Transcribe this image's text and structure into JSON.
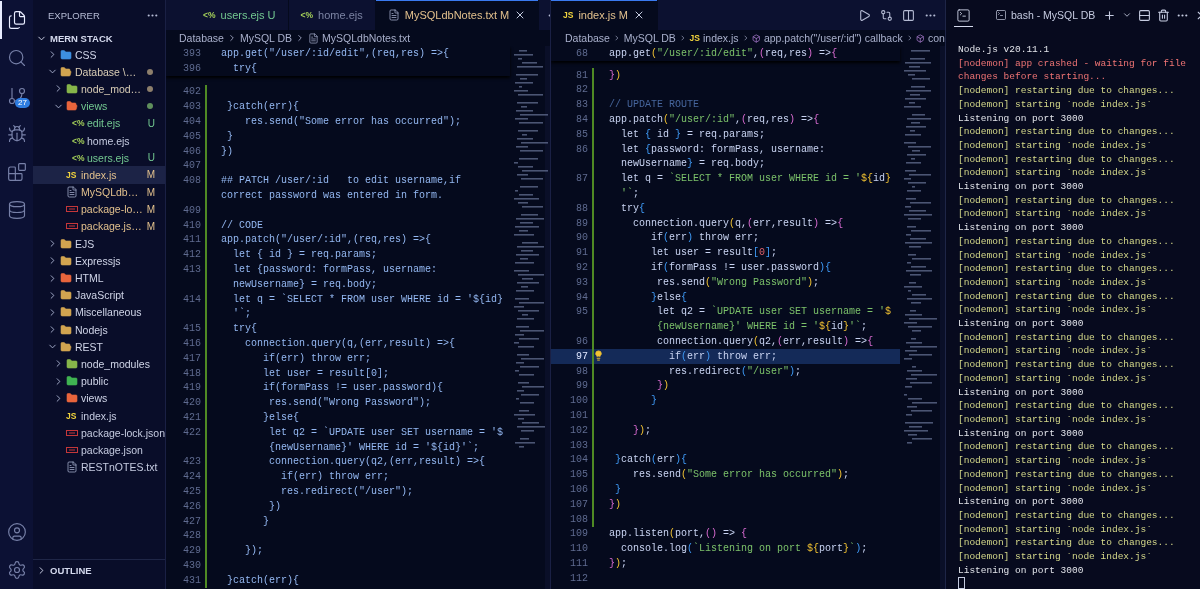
{
  "activity_bar": {
    "top": [
      {
        "kind": "explorer",
        "selected": true
      },
      {
        "kind": "search",
        "selected": false
      },
      {
        "kind": "source-control",
        "selected": false,
        "badge": "27"
      },
      {
        "kind": "run-debug",
        "selected": false
      },
      {
        "kind": "extensions",
        "selected": false
      },
      {
        "kind": "database",
        "selected": false
      }
    ],
    "bottom": [
      {
        "kind": "account",
        "selected": false
      },
      {
        "kind": "settings",
        "selected": false
      }
    ]
  },
  "sidebar": {
    "title": "EXPLORER",
    "workspace": {
      "label": "MERN STACK",
      "expanded": true
    },
    "tree": [
      {
        "label": "CSS",
        "kind": "css-folder",
        "expanded": false,
        "selected": false,
        "modified": false,
        "untracked": false
      },
      {
        "label": "Database \\…",
        "kind": "folder",
        "expanded": true,
        "selected": false,
        "modified": true,
        "untracked": false,
        "dot": true,
        "children": [
          {
            "label": "node_mod…",
            "kind": "node-folder",
            "expanded": false,
            "selected": false,
            "modified": true,
            "untracked": false,
            "dot": true
          },
          {
            "label": "views",
            "kind": "views-folder",
            "expanded": true,
            "selected": false,
            "modified": false,
            "untracked": true,
            "dot": true,
            "children": [
              {
                "label": "edit.ejs",
                "kind": "ejs",
                "icon_text": "<%",
                "selected": false,
                "modified": false,
                "untracked": true,
                "badge": "U"
              },
              {
                "label": "home.ejs",
                "kind": "ejs",
                "icon_text": "<%",
                "selected": false,
                "modified": false,
                "untracked": false
              },
              {
                "label": "users.ejs",
                "kind": "ejs",
                "icon_text": "<%",
                "selected": false,
                "modified": false,
                "untracked": true,
                "badge": "U"
              }
            ]
          },
          {
            "label": "index.js",
            "kind": "js",
            "icon_text": "JS",
            "selected": true,
            "modified": true,
            "untracked": false,
            "badge": "M"
          },
          {
            "label": "MySQLdb…",
            "kind": "txt",
            "selected": false,
            "modified": true,
            "untracked": false,
            "badge": "M"
          },
          {
            "label": "package-lo…",
            "kind": "json",
            "selected": false,
            "modified": true,
            "untracked": false,
            "badge": "M"
          },
          {
            "label": "package.js…",
            "kind": "json",
            "selected": false,
            "modified": true,
            "untracked": false,
            "badge": "M"
          }
        ]
      },
      {
        "label": "EJS",
        "kind": "folder",
        "expanded": false,
        "selected": false,
        "modified": false,
        "untracked": false
      },
      {
        "label": "Expressjs",
        "kind": "folder",
        "expanded": false,
        "selected": false,
        "modified": false,
        "untracked": false
      },
      {
        "label": "HTML",
        "kind": "html-folder",
        "expanded": false,
        "selected": false,
        "modified": false,
        "untracked": false
      },
      {
        "label": "JavaScript",
        "kind": "folder",
        "expanded": false,
        "selected": false,
        "modified": false,
        "untracked": false
      },
      {
        "label": "Miscellaneous",
        "kind": "folder",
        "expanded": false,
        "selected": false,
        "modified": false,
        "untracked": false
      },
      {
        "label": "Nodejs",
        "kind": "folder",
        "expanded": false,
        "selected": false,
        "modified": false,
        "untracked": false
      },
      {
        "label": "REST",
        "kind": "folder",
        "expanded": true,
        "selected": false,
        "modified": false,
        "untracked": false,
        "children": [
          {
            "label": "node_modules",
            "kind": "node-folder",
            "expanded": false,
            "selected": false,
            "modified": false,
            "untracked": false
          },
          {
            "label": "public",
            "kind": "public-folder",
            "expanded": false,
            "selected": false,
            "modified": false,
            "untracked": false
          },
          {
            "label": "views",
            "kind": "views-folder",
            "expanded": false,
            "selected": false,
            "modified": false,
            "untracked": false
          },
          {
            "label": "index.js",
            "kind": "js",
            "icon_text": "JS",
            "selected": false,
            "modified": false,
            "untracked": false
          },
          {
            "label": "package-lock.json",
            "kind": "json",
            "selected": false,
            "modified": false,
            "untracked": false
          },
          {
            "label": "package.json",
            "kind": "json",
            "selected": false,
            "modified": false,
            "untracked": false
          },
          {
            "label": "RESTnOTES.txt",
            "kind": "txt",
            "selected": false,
            "modified": false,
            "untracked": false
          }
        ]
      }
    ],
    "sections": [
      {
        "label": "OUTLINE",
        "expanded": false
      }
    ]
  },
  "editors": [
    {
      "kind": "text",
      "tabs": [
        {
          "label": "users.ejs",
          "badge": "U",
          "kind": "ejs",
          "icon_text": "<%",
          "modified": false,
          "untracked": true,
          "selected": false
        },
        {
          "label": "home.ejs",
          "kind": "ejs",
          "icon_text": "<%",
          "modified": false,
          "untracked": false,
          "selected": false
        },
        {
          "label": "MySQLdbNotes.txt",
          "badge": "M",
          "kind": "txt",
          "modified": true,
          "untracked": false,
          "selected": true
        }
      ],
      "actions": [
        {
          "kind": "more"
        }
      ],
      "breadcrumbs": [
        {
          "kind": "folder",
          "label": "Database"
        },
        {
          "kind": "folder",
          "label": "MySQL DB"
        },
        {
          "kind": "txt",
          "label": "MySQLdbNotes.txt"
        }
      ],
      "sticky": [
        {
          "number": "393",
          "text": "app.get(\"/user/:id/edit\",(req,res) =>{"
        },
        {
          "number": "396",
          "text": "  try{"
        }
      ],
      "lines": [
        {
          "number": "402",
          "changed": true
        },
        {
          "number": "403",
          "text": " }catch(err){",
          "changed": true
        },
        {
          "number": "404",
          "text": "    res.send(\"Some error has occurred\");",
          "changed": true
        },
        {
          "number": "405",
          "text": " }",
          "changed": true
        },
        {
          "number": "406",
          "text": "})",
          "changed": true
        },
        {
          "number": "407",
          "changed": true
        },
        {
          "number": "408",
          "text": "## PATCH /user/:id   to edit username,if",
          "changed": true
        },
        {
          "text": "correct password was entered in form.",
          "changed": true
        },
        {
          "number": "409",
          "changed": true
        },
        {
          "number": "410",
          "text": "// CODE",
          "changed": true
        },
        {
          "number": "411",
          "text": "app.patch(\"/user/:id\",(req,res) =>{",
          "changed": true
        },
        {
          "number": "412",
          "text": "  let { id } = req.params;",
          "changed": true
        },
        {
          "number": "413",
          "text": "  let {password: formPass, username:",
          "changed": true
        },
        {
          "text": "  newUsername} = req.body;",
          "changed": true
        },
        {
          "number": "414",
          "text": "  let q = `SELECT * FROM user WHERE id = '${id}",
          "changed": true
        },
        {
          "text": "  '`;",
          "changed": true
        },
        {
          "number": "415",
          "text": "  try{",
          "changed": true
        },
        {
          "number": "416",
          "text": "    connection.query(q,(err,result) =>{",
          "changed": true
        },
        {
          "number": "417",
          "text": "       if(err) throw err;",
          "changed": true
        },
        {
          "number": "418",
          "text": "       let user = result[0];",
          "changed": true
        },
        {
          "number": "419",
          "text": "       if(formPass != user.password){",
          "changed": true
        },
        {
          "number": "420",
          "text": "        res.send(\"Wrong Password\");",
          "changed": true
        },
        {
          "number": "421",
          "text": "       }else{",
          "changed": true
        },
        {
          "number": "422",
          "text": "        let q2 = `UPDATE user SET username = '$",
          "changed": true
        },
        {
          "text": "        {newUsername}' WHERE id = '${id}'`;",
          "changed": true
        },
        {
          "number": "423",
          "text": "        connection.query(q2,(err,result) =>{",
          "changed": true
        },
        {
          "number": "424",
          "text": "          if(err) throw err;",
          "changed": true
        },
        {
          "number": "425",
          "text": "          res.redirect(\"/user\");",
          "changed": true
        },
        {
          "number": "426",
          "text": "        })",
          "changed": true
        },
        {
          "number": "427",
          "text": "       }",
          "changed": true
        },
        {
          "number": "428",
          "changed": true
        },
        {
          "number": "429",
          "text": "    });",
          "changed": true
        },
        {
          "number": "430",
          "changed": true
        },
        {
          "number": "431",
          "text": " }catch(err){",
          "changed": true
        }
      ]
    },
    {
      "kind": "javascript",
      "tabs": [
        {
          "label": "index.js",
          "badge": "M",
          "kind": "js",
          "icon_text": "JS",
          "modified": true,
          "untracked": false,
          "selected": true
        }
      ],
      "actions": [
        {
          "kind": "run"
        },
        {
          "kind": "compare"
        },
        {
          "kind": "split"
        },
        {
          "kind": "more"
        }
      ],
      "breadcrumbs": [
        {
          "kind": "folder",
          "label": "Database"
        },
        {
          "kind": "folder",
          "label": "MySQL DB"
        },
        {
          "kind": "js",
          "icon_text": "JS",
          "label": "index.js"
        },
        {
          "kind": "symbol",
          "label": "app.patch(\"/user/:id\") callback"
        },
        {
          "kind": "symbol",
          "label": "con"
        }
      ],
      "sticky": [
        {
          "number": "68",
          "text": "app.get(\"/user/:id/edit\",(req,res) =>{"
        }
      ],
      "lines": [
        {
          "number": "81",
          "text": "})",
          "changed": true,
          "current": false
        },
        {
          "number": "82",
          "changed": true,
          "current": false
        },
        {
          "number": "83",
          "text": "// UPDATE ROUTE",
          "changed": true,
          "current": false
        },
        {
          "number": "84",
          "text": "app.patch(\"/user/:id\",(req,res) =>{",
          "changed": true,
          "current": false
        },
        {
          "number": "85",
          "text": "  let { id } = req.params;",
          "changed": true,
          "current": false
        },
        {
          "number": "86",
          "text": "  let {password: formPass, username:",
          "changed": true,
          "current": false
        },
        {
          "text": "  newUsername} = req.body;",
          "changed": true,
          "current": false
        },
        {
          "number": "87",
          "text": "  let q = `SELECT * FROM user WHERE id = '${id}",
          "changed": true,
          "current": false
        },
        {
          "text": "  '`;",
          "changed": true,
          "current": false
        },
        {
          "number": "88",
          "text": "  try{",
          "changed": true,
          "current": false
        },
        {
          "number": "89",
          "text": "    connection.query(q,(err,result) =>{",
          "changed": true,
          "current": false
        },
        {
          "number": "90",
          "text": "       if(err) throw err;",
          "changed": true,
          "current": false
        },
        {
          "number": "91",
          "text": "       let user = result[0];",
          "changed": true,
          "current": false
        },
        {
          "number": "92",
          "text": "       if(formPass != user.password){",
          "changed": true,
          "current": false
        },
        {
          "number": "93",
          "text": "        res.send(\"Wrong Password\");",
          "changed": true,
          "current": false
        },
        {
          "number": "94",
          "text": "       }else{",
          "changed": true,
          "current": false
        },
        {
          "number": "95",
          "text": "        let q2 = `UPDATE user SET username = '$",
          "changed": true,
          "current": false
        },
        {
          "text": "        {newUsername}' WHERE id = '${id}'`;",
          "changed": true,
          "current": false
        },
        {
          "number": "96",
          "text": "        connection.query(q2,(err,result) =>{",
          "changed": true,
          "current": false
        },
        {
          "number": "97",
          "text": "          if(err) throw err;",
          "changed": true,
          "current": true
        },
        {
          "number": "98",
          "text": "          res.redirect(\"/user\");",
          "changed": true,
          "current": false
        },
        {
          "number": "99",
          "text": "        })",
          "changed": true,
          "current": false
        },
        {
          "number": "100",
          "text": "       }",
          "changed": true,
          "current": false
        },
        {
          "number": "101",
          "changed": true,
          "current": false
        },
        {
          "number": "102",
          "text": "    });",
          "changed": true,
          "current": false
        },
        {
          "number": "103",
          "changed": true,
          "current": false
        },
        {
          "number": "104",
          "text": " }catch(err){",
          "changed": true,
          "current": false
        },
        {
          "number": "105",
          "text": "    res.send(\"Some error has occurred\");",
          "changed": true,
          "current": false
        },
        {
          "number": "106",
          "text": " }",
          "changed": true,
          "current": false
        },
        {
          "number": "107",
          "text": "})",
          "changed": true,
          "current": false
        },
        {
          "number": "108",
          "changed": true,
          "current": false
        },
        {
          "number": "109",
          "text": "app.listen(port,() => {",
          "changed": false,
          "current": false
        },
        {
          "number": "110",
          "text": "  console.log(`Listening on port ${port}`);",
          "changed": false,
          "current": false
        },
        {
          "number": "111",
          "text": "});",
          "changed": false,
          "current": false
        },
        {
          "number": "112",
          "changed": false,
          "current": false
        }
      ]
    }
  ],
  "terminal": {
    "views": [
      {
        "kind": "terminal",
        "selected": true
      }
    ],
    "title": "bash - MySQL DB",
    "actions": [
      {
        "kind": "add"
      },
      {
        "kind": "dropdown"
      },
      {
        "kind": "split"
      },
      {
        "kind": "kill"
      },
      {
        "kind": "more"
      },
      {
        "kind": "close"
      }
    ],
    "lines": [
      {
        "kind": "info",
        "text": "Node.js v20.11.1"
      },
      {
        "kind": "error",
        "text": "[nodemon] app crashed - waiting for file changes before starting..."
      },
      {
        "kind": "nodemon",
        "text": "[nodemon] restarting due to changes..."
      },
      {
        "kind": "nodemon",
        "text": "[nodemon] starting `node index.js`"
      },
      {
        "kind": "info",
        "text": "Listening on port 3000"
      },
      {
        "kind": "nodemon",
        "text": "[nodemon] restarting due to changes..."
      },
      {
        "kind": "nodemon",
        "text": "[nodemon] starting `node index.js`"
      },
      {
        "kind": "nodemon",
        "text": "[nodemon] restarting due to changes..."
      },
      {
        "kind": "nodemon",
        "text": "[nodemon] starting `node index.js`"
      },
      {
        "kind": "info",
        "text": "Listening on port 3000"
      },
      {
        "kind": "nodemon",
        "text": "[nodemon] restarting due to changes..."
      },
      {
        "kind": "nodemon",
        "text": "[nodemon] starting `node index.js`"
      },
      {
        "kind": "info",
        "text": "Listening on port 3000"
      },
      {
        "kind": "nodemon",
        "text": "[nodemon] restarting due to changes..."
      },
      {
        "kind": "nodemon",
        "text": "[nodemon] starting `node index.js`"
      },
      {
        "kind": "nodemon",
        "text": "[nodemon] restarting due to changes..."
      },
      {
        "kind": "nodemon",
        "text": "[nodemon] starting `node index.js`"
      },
      {
        "kind": "nodemon",
        "text": "[nodemon] restarting due to changes..."
      },
      {
        "kind": "nodemon",
        "text": "[nodemon] starting `node index.js`"
      },
      {
        "kind": "info",
        "text": "Listening on port 3000"
      },
      {
        "kind": "nodemon",
        "text": "[nodemon] restarting due to changes..."
      },
      {
        "kind": "nodemon",
        "text": "[nodemon] starting `node index.js`"
      },
      {
        "kind": "nodemon",
        "text": "[nodemon] restarting due to changes..."
      },
      {
        "kind": "nodemon",
        "text": "[nodemon] starting `node index.js`"
      },
      {
        "kind": "info",
        "text": "Listening on port 3000"
      },
      {
        "kind": "nodemon",
        "text": "[nodemon] restarting due to changes..."
      },
      {
        "kind": "nodemon",
        "text": "[nodemon] starting `node index.js`"
      },
      {
        "kind": "info",
        "text": "Listening on port 3000"
      },
      {
        "kind": "nodemon",
        "text": "[nodemon] restarting due to changes..."
      },
      {
        "kind": "nodemon",
        "text": "[nodemon] starting `node index.js`"
      },
      {
        "kind": "nodemon",
        "text": "[nodemon] restarting due to changes..."
      },
      {
        "kind": "nodemon",
        "text": "[nodemon] starting `node index.js`"
      },
      {
        "kind": "info",
        "text": "Listening on port 3000"
      },
      {
        "kind": "nodemon",
        "text": "[nodemon] restarting due to changes..."
      },
      {
        "kind": "nodemon",
        "text": "[nodemon] starting `node index.js`"
      },
      {
        "kind": "nodemon",
        "text": "[nodemon] restarting due to changes..."
      },
      {
        "kind": "nodemon",
        "text": "[nodemon] starting `node index.js`"
      },
      {
        "kind": "info",
        "text": "Listening on port 3000"
      }
    ]
  }
}
